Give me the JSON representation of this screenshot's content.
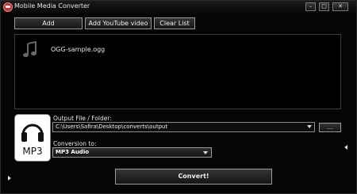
{
  "window": {
    "title": "Mobile Media Converter",
    "controls": {
      "minimize": "–",
      "maximize": "□",
      "close": "✕"
    }
  },
  "toolbar": {
    "add_label": "Add",
    "add_youtube_label": "Add YouTube video",
    "clear_list_label": "Clear List"
  },
  "file_list": {
    "items": [
      {
        "name": "OGG-sample.ogg",
        "icon": "music-note-icon"
      }
    ]
  },
  "format_tile": {
    "label": "MP3",
    "icon": "headphones-icon"
  },
  "output": {
    "label": "Output File / Folder:",
    "path": "C:\\Users\\Safira\\Desktop\\converts\\output",
    "browse_label": "..."
  },
  "conversion": {
    "label": "Conversion to:",
    "selected": "MP3 Audio"
  },
  "convert_label": "Convert!",
  "colors": {
    "background": "#050505",
    "list_bg": "#000000",
    "button_border": "#9a9a9a"
  }
}
